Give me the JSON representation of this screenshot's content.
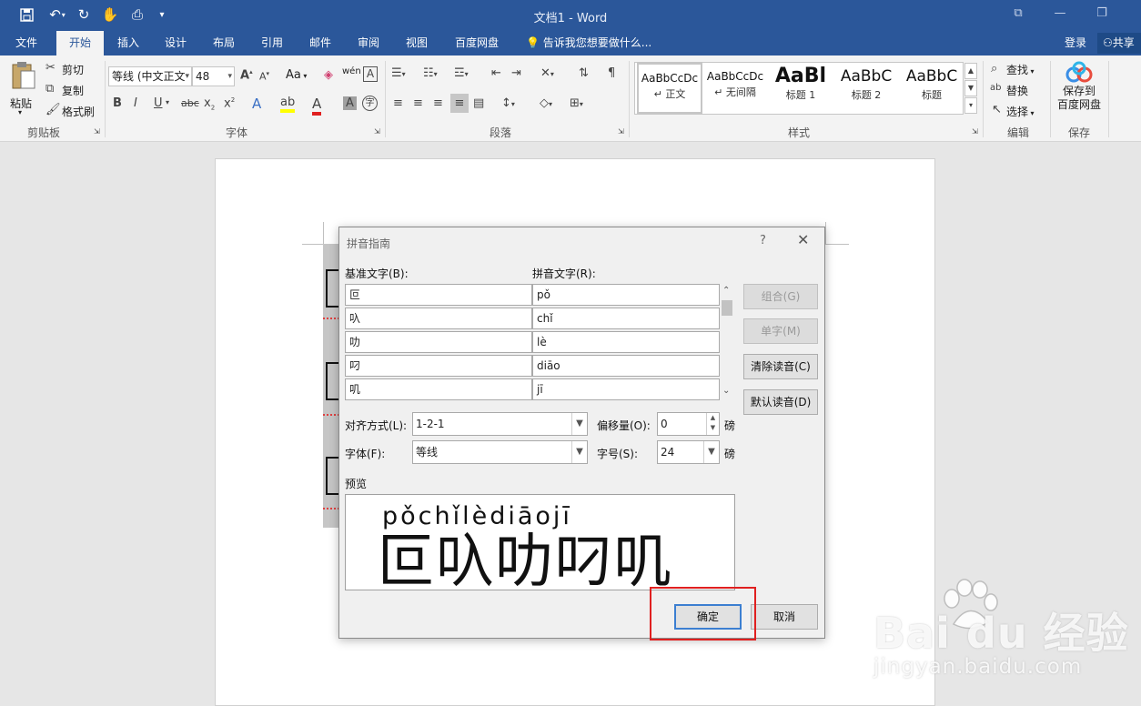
{
  "window": {
    "title": "文档1 - Word",
    "minimize_glyph": "—",
    "restore_glyph": "❐",
    "close_glyph": "✕",
    "ribbon_opt_glyph": "⧉"
  },
  "tabs": [
    "文件",
    "开始",
    "插入",
    "设计",
    "布局",
    "引用",
    "邮件",
    "审阅",
    "视图",
    "百度网盘"
  ],
  "tell_me": "告诉我您想要做什么...",
  "login": "登录",
  "share": "共享",
  "ribbon": {
    "clipboard": {
      "paste": "粘贴",
      "cut": "剪切",
      "copy": "复制",
      "format_painter": "格式刷",
      "group": "剪贴板"
    },
    "font": {
      "font_name": "等线 (中文正文",
      "font_size": "48",
      "change_case": "Aa",
      "phonetic": "wén",
      "group": "字体"
    },
    "paragraph": {
      "group": "段落"
    },
    "styles": {
      "items": [
        {
          "preview": "AaBbCcDc",
          "name": "正文"
        },
        {
          "preview": "AaBbCcDc",
          "name": "无间隔"
        },
        {
          "preview": "AaBl",
          "name": "标题 1"
        },
        {
          "preview": "AaBbC",
          "name": "标题 2"
        },
        {
          "preview": "AaBbC",
          "name": "标题"
        }
      ],
      "group": "样式"
    },
    "editing": {
      "find": "查找",
      "replace": "替换",
      "select": "选择",
      "group": "编辑"
    },
    "save": {
      "button": "保存到\n百度网盘",
      "line1": "保存到",
      "line2": "百度网盘",
      "group": "保存"
    }
  },
  "dialog": {
    "title": "拼音指南",
    "help": "?",
    "close": "✕",
    "base_label": "基准文字(B):",
    "ruby_label": "拼音文字(R):",
    "rows": [
      {
        "base": "叵",
        "ruby": "pǒ"
      },
      {
        "base": "叺",
        "ruby": "chǐ"
      },
      {
        "base": "叻",
        "ruby": "lè"
      },
      {
        "base": "叼",
        "ruby": "diāo"
      },
      {
        "base": "叽",
        "ruby": "jī"
      }
    ],
    "buttons": {
      "group": "组合(G)",
      "mono": "单字(M)",
      "clear": "清除读音(C)",
      "default": "默认读音(D)",
      "ok": "确定",
      "cancel": "取消"
    },
    "alignment_label": "对齐方式(L):",
    "alignment_value": "1-2-1",
    "offset_label": "偏移量(O):",
    "offset_value": "0",
    "offset_unit": "磅",
    "font_label": "字体(F):",
    "font_value": "等线",
    "size_label": "字号(S):",
    "size_value": "24",
    "size_unit": "磅",
    "preview_label": "预览",
    "preview_pinyin": "pǒchǐlèdiāojī",
    "preview_chars": "叵叺叻叼叽"
  },
  "watermark": {
    "brand": "Bai du 经验",
    "url": "jingyan.baidu.com"
  }
}
